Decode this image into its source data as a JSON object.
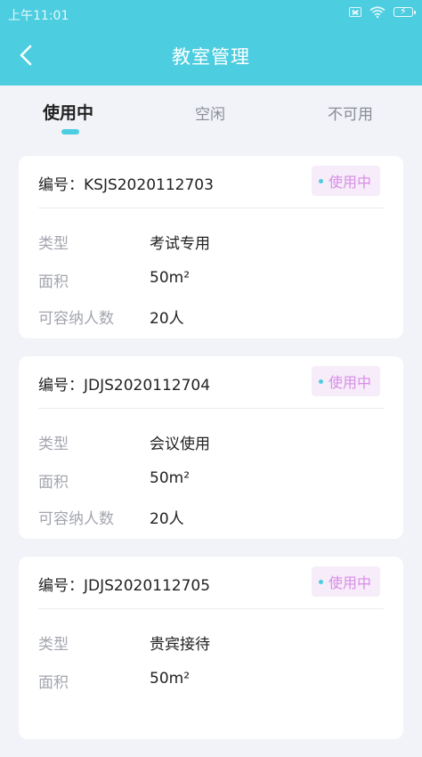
{
  "status_bar": {
    "time": "上午11:01"
  },
  "header": {
    "title": "教室管理",
    "back_icon": "chevron-left-icon"
  },
  "tabs": [
    {
      "label": "使用中",
      "active": true
    },
    {
      "label": "空闲",
      "active": false
    },
    {
      "label": "不可用",
      "active": false
    }
  ],
  "labels": {
    "type": "类型",
    "area": "面积",
    "capacity": "可容纳人数"
  },
  "rooms": [
    {
      "code": "编号：KSJS2020112703",
      "status": "使用中",
      "type": "考试专用",
      "area": "50m²",
      "capacity": "20人"
    },
    {
      "code": "编号：JDJS2020112704",
      "status": "使用中",
      "type": "会议使用",
      "area": "50m²",
      "capacity": "20人"
    },
    {
      "code": "编号：JDJS2020112705",
      "status": "使用中",
      "type": "贵宾接待",
      "area": "50m²",
      "capacity": ""
    }
  ],
  "colors": {
    "accent": "#4ccde0",
    "status_text": "#d78ee6",
    "status_bg": "#f7ecf9"
  }
}
